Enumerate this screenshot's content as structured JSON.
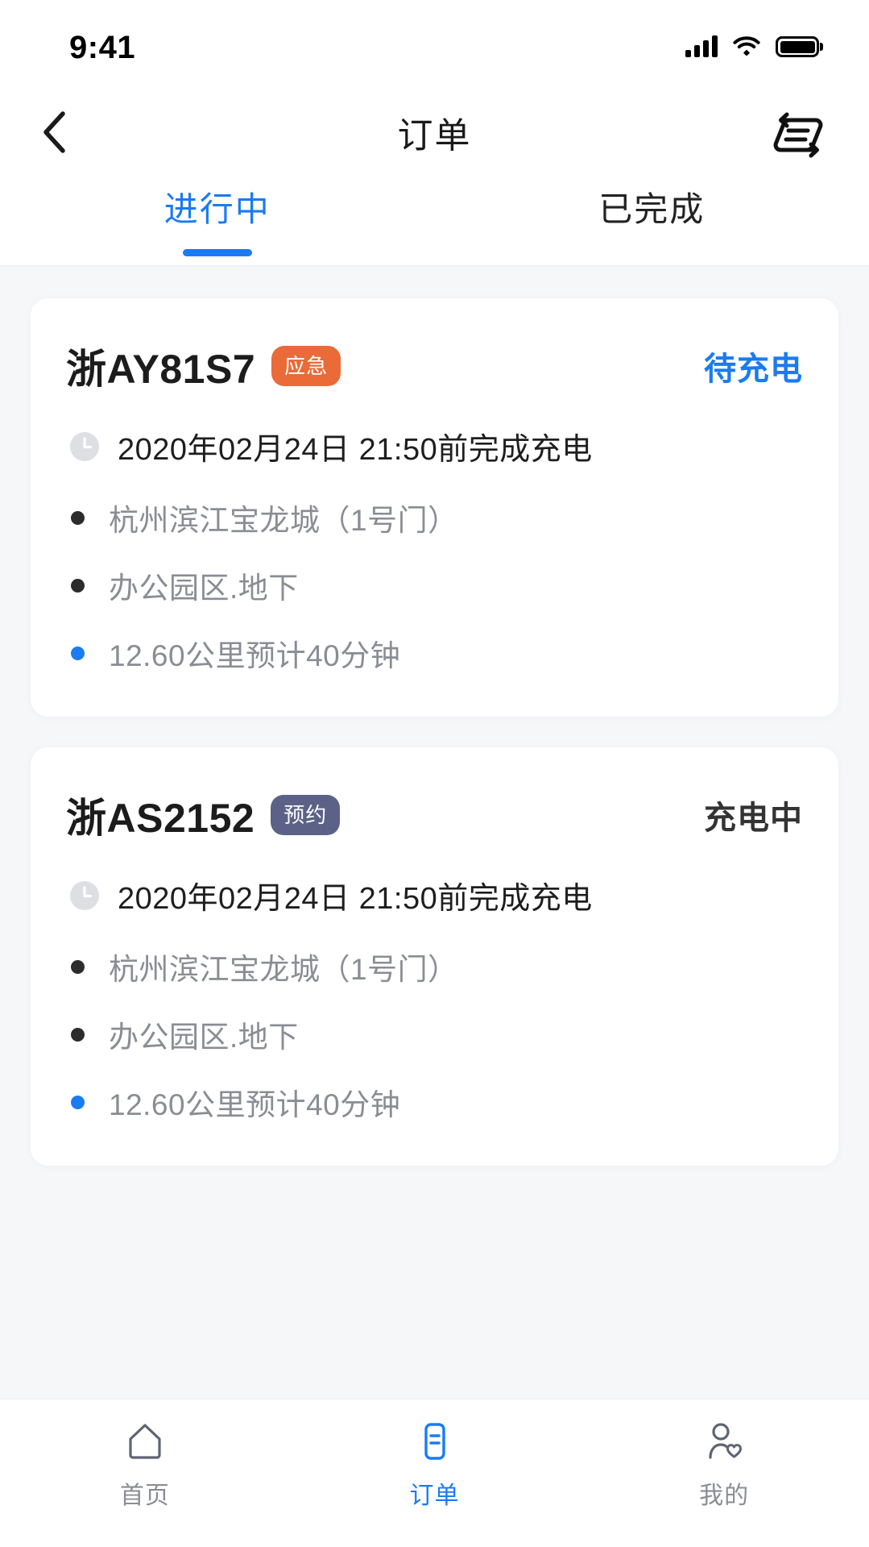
{
  "status_bar": {
    "time": "9:41",
    "icons": [
      "signal-bars-icon",
      "wifi-icon",
      "battery-icon"
    ]
  },
  "header": {
    "title": "订单",
    "back_icon": "back-chevron-icon",
    "action_icon": "transaction-record-icon"
  },
  "tabs": {
    "items": [
      {
        "label": "进行中",
        "active": true
      },
      {
        "label": "已完成",
        "active": false
      }
    ]
  },
  "colors": {
    "accent_blue": "#1A7BF2",
    "badge_orange": "#EA6A38",
    "badge_slate": "#5C6287",
    "page_background": "#F6F7F9",
    "card_background": "#FFFFFF",
    "muted_text": "#8A8D93",
    "primary_text": "#1C1C1C"
  },
  "orders": [
    {
      "plate": "浙AY81S7",
      "badge_label": "应急",
      "badge_color": "#EA6A38",
      "status_label": "待充电",
      "status_color": "#1A7BF2",
      "clock_icon": "clock-icon",
      "deadline": "2020年02月24日 21:50前完成充电",
      "details": [
        {
          "text": "杭州滨江宝龙城（1号门）",
          "dot_color": "#2C2C2C"
        },
        {
          "text": "办公园区.地下",
          "dot_color": "#2C2C2C"
        },
        {
          "text": "12.60公里预计40分钟",
          "dot_color": "#1A7BF2"
        }
      ]
    },
    {
      "plate": "浙AS2152",
      "badge_label": "预约",
      "badge_color": "#5C6287",
      "status_label": "充电中",
      "status_color": "#333333",
      "clock_icon": "clock-icon",
      "deadline": "2020年02月24日 21:50前完成充电",
      "details": [
        {
          "text": "杭州滨江宝龙城（1号门）",
          "dot_color": "#2C2C2C"
        },
        {
          "text": "办公园区.地下",
          "dot_color": "#2C2C2C"
        },
        {
          "text": "12.60公里预计40分钟",
          "dot_color": "#1A7BF2"
        }
      ]
    }
  ],
  "bottom_nav": {
    "items": [
      {
        "label": "首页",
        "icon": "home-icon",
        "active": false
      },
      {
        "label": "订单",
        "icon": "order-document-icon",
        "active": true
      },
      {
        "label": "我的",
        "icon": "profile-heart-icon",
        "active": false
      }
    ]
  }
}
